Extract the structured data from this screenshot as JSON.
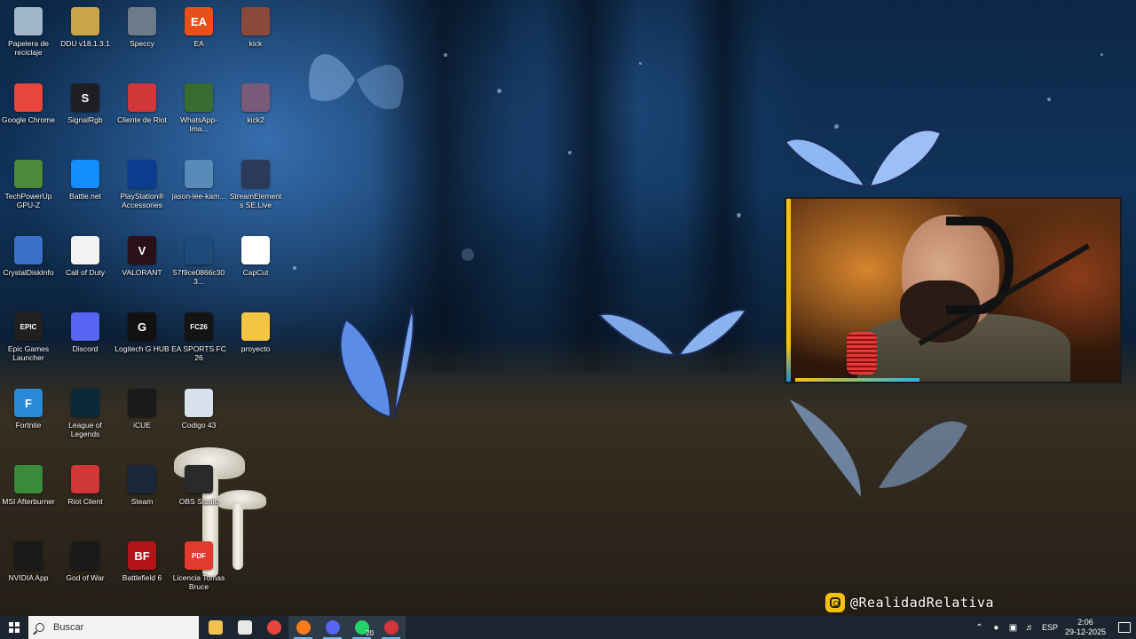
{
  "desktop_icons": [
    {
      "label": "Papelera de reciclaje",
      "icon": "recycle-bin-icon",
      "color": "#9fb7c9"
    },
    {
      "label": "DDU v18.1.3.1",
      "icon": "ddu-icon",
      "color": "#c9a64a"
    },
    {
      "label": "Speccy",
      "icon": "speccy-icon",
      "color": "#6b7b8a"
    },
    {
      "label": "EA",
      "icon": "ea-icon",
      "color": "#e8501a",
      "glyph": "EA"
    },
    {
      "label": "kick",
      "icon": "kick-photo-icon",
      "color": "#8a4a3a"
    },
    {
      "label": "Google Chrome",
      "icon": "chrome-icon",
      "color": "#e8453c"
    },
    {
      "label": "SignalRgb",
      "icon": "signalrgb-icon",
      "color": "#1e1e24",
      "glyph": "S"
    },
    {
      "label": "Cliente de Riot",
      "icon": "riot-client-icon",
      "color": "#d13639"
    },
    {
      "label": "WhatsApp-Ima...",
      "icon": "image-file-icon",
      "color": "#3a6b2e"
    },
    {
      "label": "kick2",
      "icon": "kick2-photo-icon",
      "color": "#7a5a78"
    },
    {
      "label": "TechPowerUp GPU-Z",
      "icon": "gpuz-icon",
      "color": "#4c8a3a"
    },
    {
      "label": "Battle.net",
      "icon": "battlenet-icon",
      "color": "#148eff"
    },
    {
      "label": "PlayStation® Accessories",
      "icon": "playstation-icon",
      "color": "#0a3d8f"
    },
    {
      "label": "jason-lee-kam...",
      "icon": "image-file-icon",
      "color": "#5a8ab8"
    },
    {
      "label": "StreamElements SE.Live",
      "icon": "streamelements-icon",
      "color": "#2a3a5a"
    },
    {
      "label": "CrystalDiskInfo",
      "icon": "crystaldiskinfo-icon",
      "color": "#3c6fc8"
    },
    {
      "label": "Call of Duty",
      "icon": "blank-file-icon",
      "color": "#f2f2f2"
    },
    {
      "label": "VALORANT",
      "icon": "valorant-icon",
      "color": "#2a1018",
      "glyph": "V"
    },
    {
      "label": "57f9ce0866c303...",
      "icon": "image-file-icon",
      "color": "#1e4a7a"
    },
    {
      "label": "CapCut",
      "icon": "capcut-icon",
      "color": "#ffffff"
    },
    {
      "label": "Epic Games Launcher",
      "icon": "epic-games-icon",
      "color": "#202020",
      "glyph": "EPIC"
    },
    {
      "label": "Discord",
      "icon": "discord-icon",
      "color": "#5865f2"
    },
    {
      "label": "Logitech G HUB",
      "icon": "logitech-ghub-icon",
      "color": "#111111",
      "glyph": "G"
    },
    {
      "label": "EA SPORTS FC 26",
      "icon": "fc26-icon",
      "color": "#141414",
      "glyph": "FC26"
    },
    {
      "label": "proyecto",
      "icon": "folder-icon",
      "color": "#f5c542"
    },
    {
      "label": "Fortnite",
      "icon": "fortnite-icon",
      "color": "#2a8ad8",
      "glyph": "F"
    },
    {
      "label": "League of Legends",
      "icon": "league-icon",
      "color": "#0a2a3a"
    },
    {
      "label": "iCUE",
      "icon": "icue-icon",
      "color": "#1a1a1a"
    },
    {
      "label": "Codigo 43",
      "icon": "image-file-icon",
      "color": "#d8e2ec"
    },
    null,
    {
      "label": "MSI Afterburner",
      "icon": "msi-afterburner-icon",
      "color": "#3a8a3a"
    },
    {
      "label": "Riot Client",
      "icon": "riot-client-icon",
      "color": "#d13639"
    },
    {
      "label": "Steam",
      "icon": "steam-icon",
      "color": "#1b2838"
    },
    {
      "label": "OBS Studio",
      "icon": "obs-icon",
      "color": "#2a2a2a"
    },
    null,
    {
      "label": "NVIDIA App",
      "icon": "nvidia-icon",
      "color": "#1a1a1a"
    },
    {
      "label": "God of War",
      "icon": "godofwar-icon",
      "color": "#1a1a1a"
    },
    {
      "label": "Battlefield 6",
      "icon": "battlefield-icon",
      "color": "#b3141a",
      "glyph": "BF"
    },
    {
      "label": "Licencia Tomas Bruce",
      "icon": "pdf-icon",
      "color": "#e23a2e",
      "glyph": "PDF"
    },
    null
  ],
  "overlay": {
    "handle": "@RealidadRelativa",
    "accent": "#f4c20d"
  },
  "taskbar": {
    "search_placeholder": "Buscar",
    "apps": [
      {
        "name": "file-explorer",
        "icon": "folder-icon",
        "color": "#f2c14e",
        "active": false
      },
      {
        "name": "microsoft-store",
        "icon": "store-icon",
        "color": "#e8e8e8",
        "active": false
      },
      {
        "name": "google-chrome",
        "icon": "chrome-icon",
        "color": "#e8453c",
        "active": false
      },
      {
        "name": "firefox",
        "icon": "firefox-icon",
        "color": "#ff7a1a",
        "active": true
      },
      {
        "name": "discord",
        "icon": "discord-icon",
        "color": "#5865f2",
        "active": true
      },
      {
        "name": "whatsapp",
        "icon": "whatsapp-icon",
        "color": "#25d366",
        "active": true,
        "badge": "20"
      },
      {
        "name": "riot-client",
        "icon": "riot-icon",
        "color": "#d13639",
        "active": true
      }
    ],
    "tray": {
      "language": "ESP",
      "time": "2:06",
      "date": "29-12-2025"
    }
  }
}
